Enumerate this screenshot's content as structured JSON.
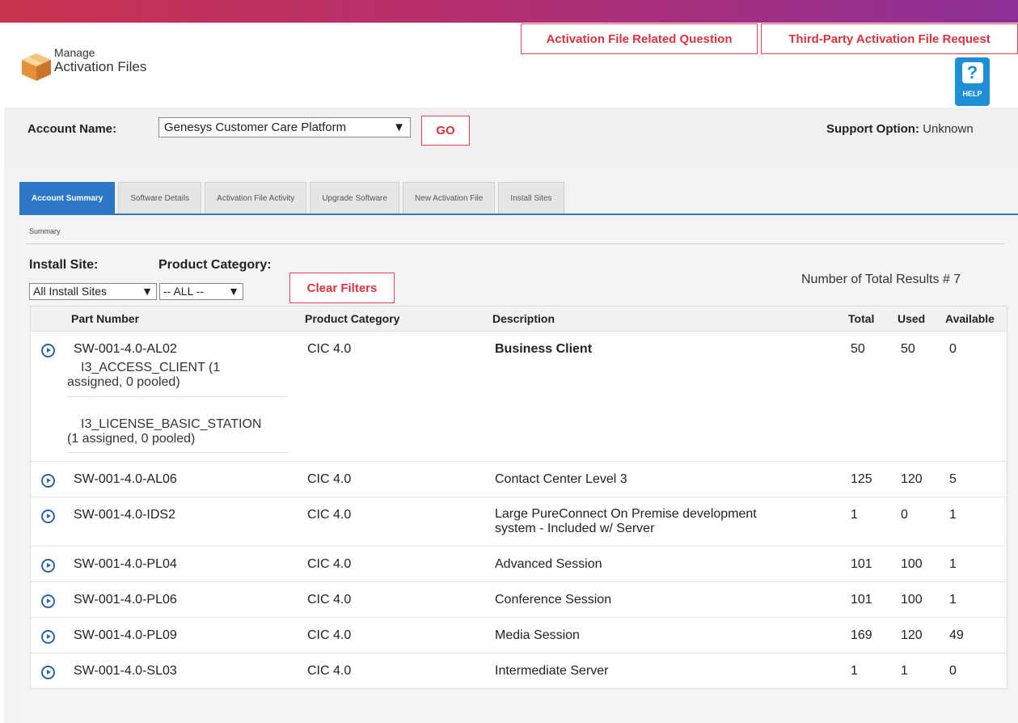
{
  "header": {
    "title_line1": "Manage",
    "title_line2": "Activation Files",
    "buttons": {
      "related_question": "Activation File Related Question",
      "third_party_request": "Third-Party Activation File Request"
    },
    "help_label": "HELP",
    "help_glyph": "?"
  },
  "account": {
    "label": "Account Name:",
    "selected": "Genesys Customer Care Platform",
    "go_label": "GO",
    "support_label": "Support Option:",
    "support_value": "Unknown"
  },
  "tabs": [
    {
      "label": "Account Summary",
      "active": true
    },
    {
      "label": "Software Details",
      "active": false
    },
    {
      "label": "Activation File Activity",
      "active": false
    },
    {
      "label": "Upgrade Software",
      "active": false
    },
    {
      "label": "New Activation File",
      "active": false
    },
    {
      "label": "Install Sites",
      "active": false
    }
  ],
  "summary": {
    "section_label": "Summary",
    "install_site_label": "Install Site:",
    "install_site_value": "All Install Sites",
    "product_category_label": "Product Category:",
    "product_category_value": "-- ALL --",
    "clear_filters_label": "Clear Filters",
    "total_results": "Number of Total Results # 7"
  },
  "table": {
    "columns": {
      "part_number": "Part Number",
      "product_category": "Product Category",
      "description": "Description",
      "total": "Total",
      "used": "Used",
      "available": "Available"
    },
    "rows": [
      {
        "part": "SW-001-4.0-AL02",
        "category": "CIC 4.0",
        "description": "Business Client",
        "total": "50",
        "used": "50",
        "available": "0",
        "sub": [
          {
            "name": "I3_ACCESS_CLIENT (1",
            "detail": "assigned, 0 pooled)"
          },
          {
            "name": "I3_LICENSE_BASIC_STATION",
            "detail": "(1 assigned, 0 pooled)"
          }
        ]
      },
      {
        "part": "SW-001-4.0-AL06",
        "category": "CIC 4.0",
        "description": "Contact Center Level 3",
        "description2": "",
        "total": "125",
        "used": "120",
        "available": "5"
      },
      {
        "part": "SW-001-4.0-IDS2",
        "category": "CIC 4.0",
        "description": "Large PureConnect On Premise development",
        "description2": "system - Included w/ Server",
        "total": "1",
        "used": "0",
        "available": "1"
      },
      {
        "part": "SW-001-4.0-PL04",
        "category": "CIC 4.0",
        "description": "Advanced Session",
        "description2": "",
        "total": "101",
        "used": "100",
        "available": "1"
      },
      {
        "part": "SW-001-4.0-PL06",
        "category": "CIC 4.0",
        "description": "Conference Session",
        "description2": "",
        "total": "101",
        "used": "100",
        "available": "1"
      },
      {
        "part": "SW-001-4.0-PL09",
        "category": "CIC 4.0",
        "description": "Media Session",
        "description2": "",
        "total": "169",
        "used": "120",
        "available": "49"
      },
      {
        "part": "SW-001-4.0-SL03",
        "category": "CIC 4.0",
        "description": "Intermediate Server",
        "description2": "",
        "total": "1",
        "used": "1",
        "available": "0"
      }
    ]
  },
  "colors": {
    "accent_red": "#d9343e",
    "tab_blue": "#2e77c8",
    "help_blue": "#1e8fd6"
  }
}
